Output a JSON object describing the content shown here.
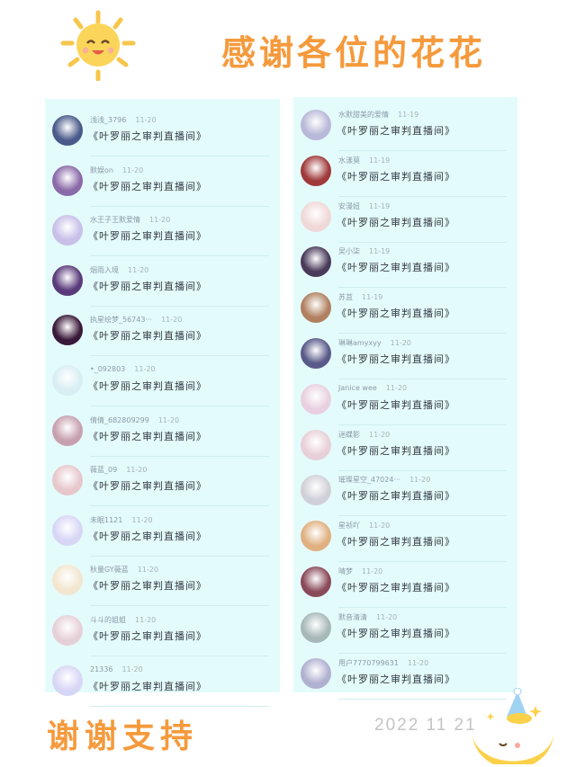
{
  "header": {
    "title": "感谢各位的花花"
  },
  "footer": {
    "thanks": "谢谢支持",
    "date": "2022 11 21"
  },
  "left_list": [
    {
      "name": "浅浅_3796",
      "date": "11-20",
      "message": "《叶罗丽之审判直播间》",
      "avatar_color": "#4a5a8a"
    },
    {
      "name": "默娱on",
      "date": "11-20",
      "message": "《叶罗丽之审判直播间》",
      "avatar_color": "#8a6aa8"
    },
    {
      "name": "水王子王默爱情",
      "date": "11-20",
      "message": "《叶罗丽之审判直播间》",
      "avatar_color": "#c8c0e8"
    },
    {
      "name": "烟雨入境",
      "date": "11-20",
      "message": "《叶罗丽之审判直播间》",
      "avatar_color": "#5a3a7a"
    },
    {
      "name": "执星绘梦_56743···",
      "date": "11-20",
      "message": "《叶罗丽之审判直播间》",
      "avatar_color": "#3a1a3a"
    },
    {
      "name": "•_092803",
      "date": "11-20",
      "message": "《叶罗丽之审判直播间》",
      "avatar_color": "#d8eef2"
    },
    {
      "name": "倩倩_682809299",
      "date": "11-20",
      "message": "《叶罗丽之审判直播间》",
      "avatar_color": "#c7a0b0"
    },
    {
      "name": "薇蓝_09",
      "date": "11-20",
      "message": "《叶罗丽之审判直播间》",
      "avatar_color": "#e6c7cc"
    },
    {
      "name": "未眠1121",
      "date": "11-20",
      "message": "《叶罗丽之审判直播间》",
      "avatar_color": "#d8d6f6"
    },
    {
      "name": "秋量GY薇蓝",
      "date": "11-20",
      "message": "《叶罗丽之审判直播间》",
      "avatar_color": "#f2e6d0"
    },
    {
      "name": "斗斗的姐姐",
      "date": "11-20",
      "message": "《叶罗丽之审判直播间》",
      "avatar_color": "#e6d0d8"
    },
    {
      "name": "21336",
      "date": "11-20",
      "message": "《叶罗丽之审判直播间》",
      "avatar_color": "#d8d6f6"
    }
  ],
  "right_list": [
    {
      "name": "水默甜美的爱情",
      "date": "11-19",
      "message": "《叶罗丽之审判直播间》",
      "avatar_color": "#b8b8d8"
    },
    {
      "name": "水漾莫",
      "date": "11-19",
      "message": "《叶罗丽之审判直播间》",
      "avatar_color": "#a03a3a"
    },
    {
      "name": "安漫妞",
      "date": "11-19",
      "message": "《叶罗丽之审判直播间》",
      "avatar_color": "#f0d8d8"
    },
    {
      "name": "吴小柒",
      "date": "11-19",
      "message": "《叶罗丽之审判直播间》",
      "avatar_color": "#4a3a5a"
    },
    {
      "name": "苏苴",
      "date": "11-19",
      "message": "《叶罗丽之审判直播间》",
      "avatar_color": "#b08060"
    },
    {
      "name": "琳琳amyxyy",
      "date": "11-20",
      "message": "《叶罗丽之审判直播间》",
      "avatar_color": "#5a5a8a"
    },
    {
      "name": "Janice wee",
      "date": "11-20",
      "message": "《叶罗丽之审判直播间》",
      "avatar_color": "#e8d0e0"
    },
    {
      "name": "迷蝶影",
      "date": "11-20",
      "message": "《叶罗丽之审判直播间》",
      "avatar_color": "#e8d0d8"
    },
    {
      "name": "璀璨星空_47024···",
      "date": "11-20",
      "message": "《叶罗丽之审判直播间》",
      "avatar_color": "#d0d0d8"
    },
    {
      "name": "星祯吖",
      "date": "11-20",
      "message": "《叶罗丽之审判直播间》",
      "avatar_color": "#e0b080"
    },
    {
      "name": "晴梦",
      "date": "11-20",
      "message": "《叶罗丽之审判直播间》",
      "avatar_color": "#8a4a5a"
    },
    {
      "name": "默音清清",
      "date": "11-20",
      "message": "《叶罗丽之审判直播间》",
      "avatar_color": "#a8b8b8"
    },
    {
      "name": "用户7770799631",
      "date": "11-20",
      "message": "《叶罗丽之审判直播间》",
      "avatar_color": "#b0b0d0"
    }
  ]
}
